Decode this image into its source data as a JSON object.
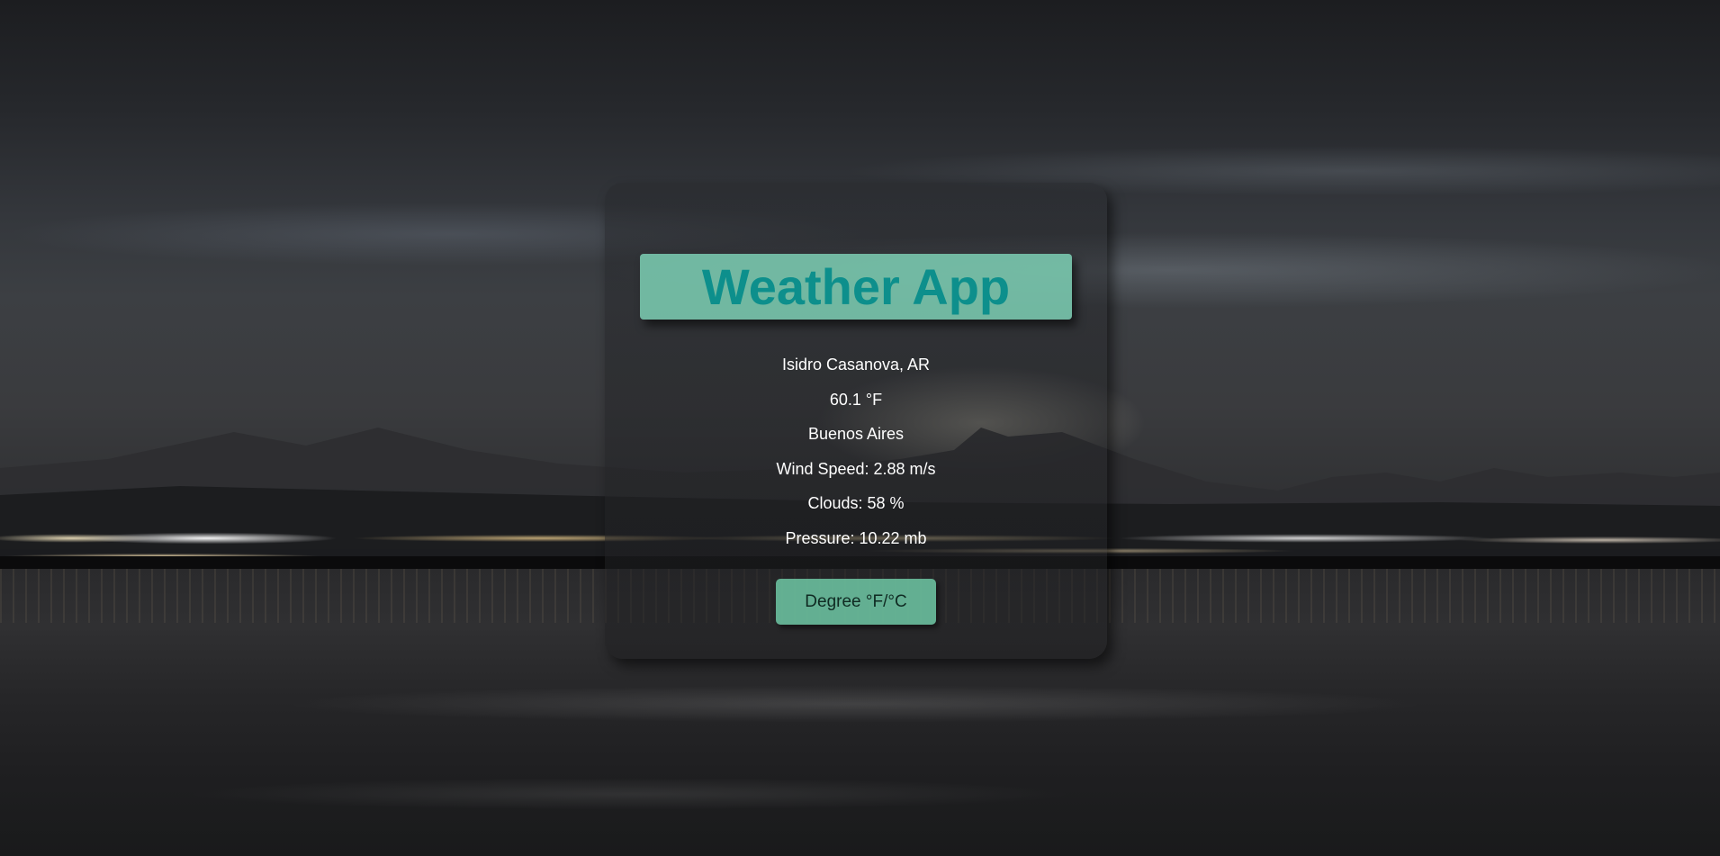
{
  "app": {
    "title": "Weather App"
  },
  "weather": {
    "location": "Isidro Casanova, AR",
    "temperature": "60.1 °F",
    "region": "Buenos Aires",
    "wind_speed": "Wind Speed: 2.88 m/s",
    "clouds": "Clouds: 58 %",
    "pressure": "Pressure: 10.22 mb"
  },
  "controls": {
    "unit_toggle_label": "Degree °F/°C"
  },
  "colors": {
    "title_box": "#80d6ba",
    "title_text": "#0d8f8c",
    "button": "#6ec8a5",
    "info_text": "#ffffff"
  }
}
